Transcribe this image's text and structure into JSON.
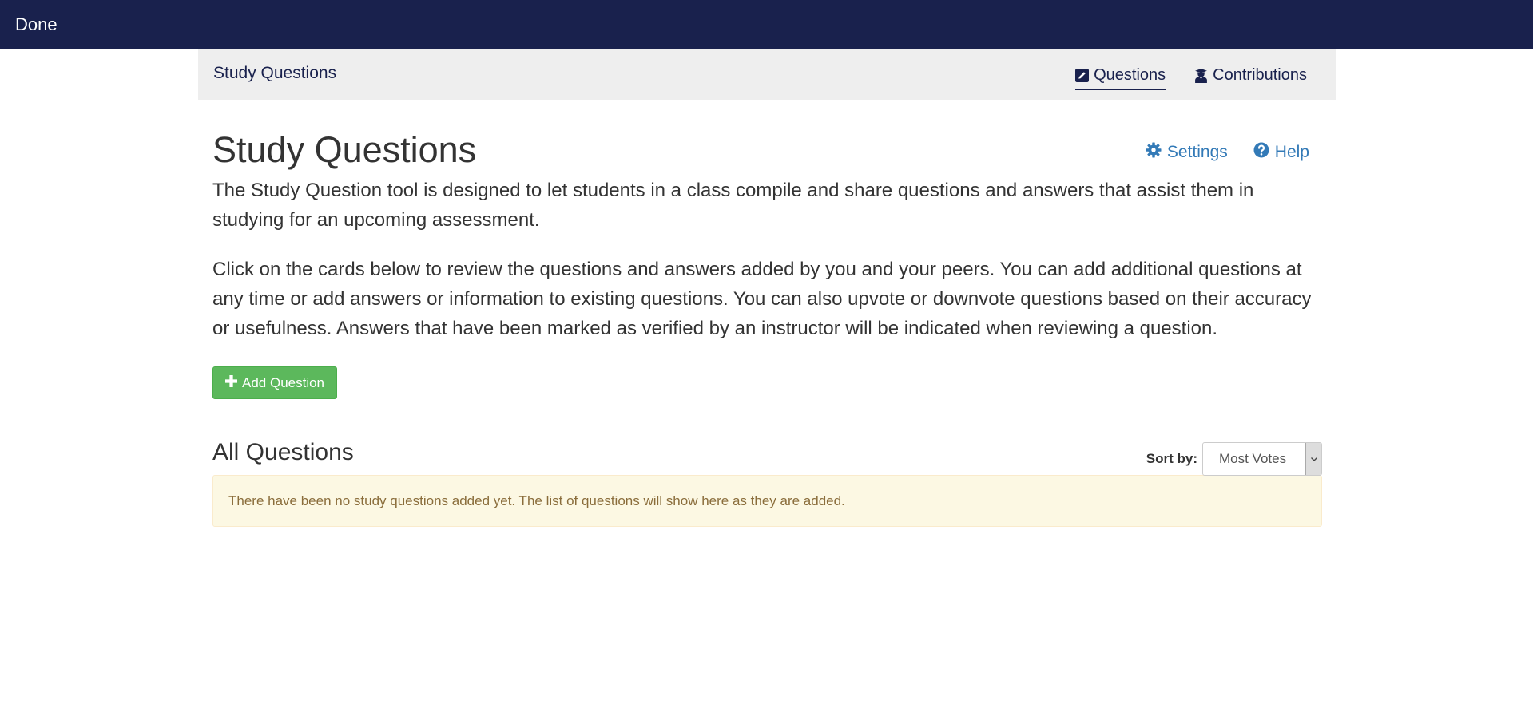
{
  "topbar": {
    "done_label": "Done"
  },
  "subnav": {
    "title": "Study Questions",
    "tabs": [
      {
        "label": "Questions",
        "icon": "edit-icon",
        "active": true
      },
      {
        "label": "Contributions",
        "icon": "user-graduate-icon",
        "active": false
      }
    ]
  },
  "page": {
    "title": "Study Questions",
    "settings_label": "Settings",
    "help_label": "Help",
    "intro_1": "The Study Question tool is designed to let students in a class compile and share questions and answers that assist them in studying for an upcoming assessment.",
    "intro_2": "Click on the cards below to review the questions and answers added by you and your peers. You can add additional questions at any time or add answers or information to existing questions. You can also upvote or downvote questions based on their accuracy or usefulness. Answers that have been marked as verified by an instructor will be indicated when reviewing a question.",
    "add_question_label": "Add Question"
  },
  "list": {
    "title": "All Questions",
    "sort_label": "Sort by:",
    "sort_value": "Most Votes",
    "empty_message": "There have been no study questions added yet. The list of questions will show here as they are added."
  },
  "colors": {
    "topbar": "#19214d",
    "link": "#337ab7",
    "success": "#5cb85c",
    "warning_bg": "#fcf8e3",
    "warning_text": "#8a6d3b"
  }
}
